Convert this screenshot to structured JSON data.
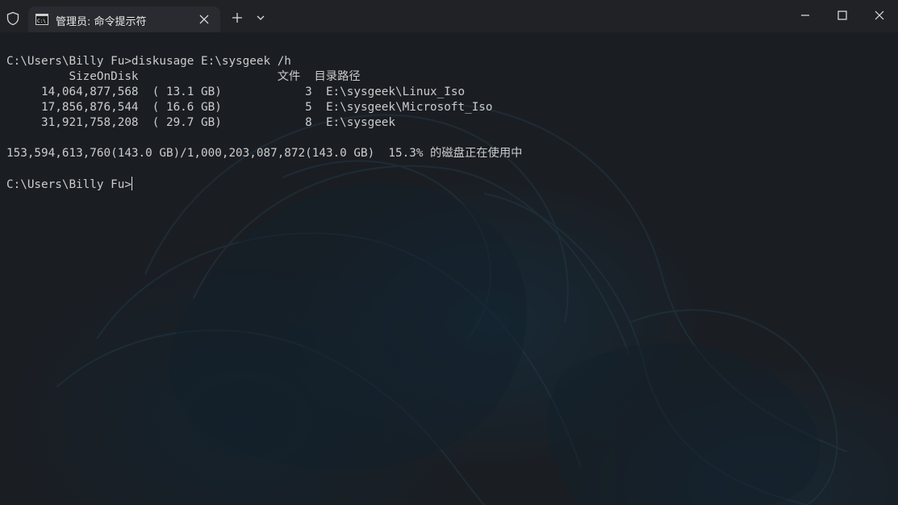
{
  "tab": {
    "title": "管理员: 命令提示符",
    "icon": "command-prompt-icon"
  },
  "terminal": {
    "lines": [
      "C:\\Users\\Billy Fu>diskusage E:\\sysgeek /h",
      "         SizeOnDisk                    文件  目录路径",
      "     14,064,877,568  ( 13.1 GB)            3  E:\\sysgeek\\Linux_Iso",
      "     17,856,876,544  ( 16.6 GB)            5  E:\\sysgeek\\Microsoft_Iso",
      "     31,921,758,208  ( 29.7 GB)            8  E:\\sysgeek",
      "",
      "153,594,613,760(143.0 GB)/1,000,203,087,872(143.0 GB)  15.3% 的磁盘正在使用中",
      ""
    ],
    "prompt": "C:\\Users\\Billy Fu>"
  },
  "colors": {
    "titlebar": "#202226",
    "tab_active": "#292b30",
    "text": "#cccccc",
    "background": "#1a1e23"
  }
}
